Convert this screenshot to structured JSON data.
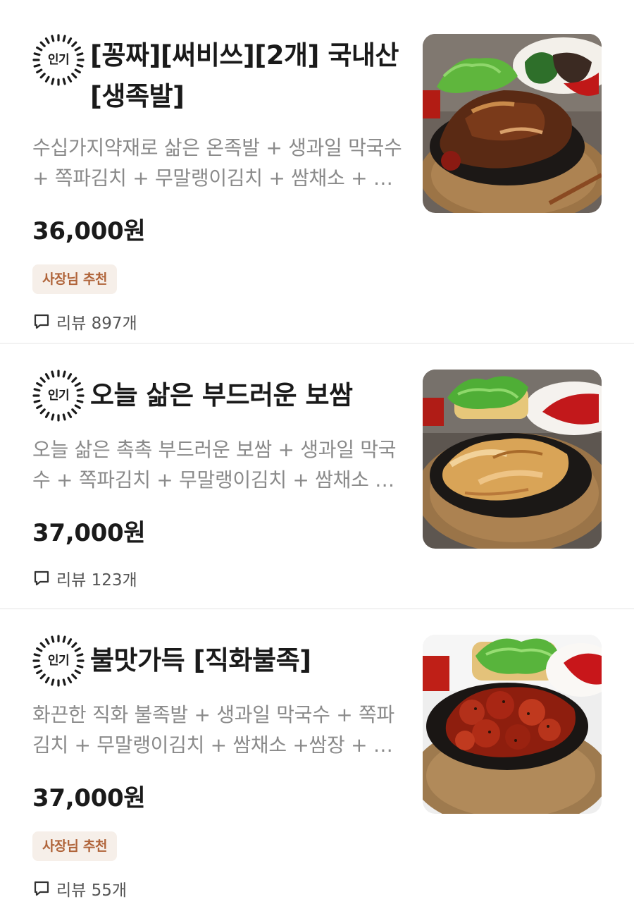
{
  "menu": {
    "items": [
      {
        "badge": "인기",
        "title": "[꽁짜][써비쓰][2개]  국내산 [생족발]",
        "description": "수십가지약재로 삶은 온족발 + 생과일 막국수 + 쪽파김치 + 무말랭이김치 + 쌈채소 + 쌈장 + 새우젓",
        "price": "36,000원",
        "recommend": "사장님 추천",
        "review": "리뷰 897개",
        "image_icon": "jokbal-photo"
      },
      {
        "badge": "인기",
        "title": "오늘 삶은 부드러운 보쌈",
        "description": "오늘 삶은 촉촉 부드러운 보쌈  + 생과일 막국수  + 쪽파김치 + 무말랭이김치 + 쌈채소 + 쌈장",
        "price": "37,000원",
        "recommend": "",
        "review": "리뷰 123개",
        "image_icon": "bossam-photo"
      },
      {
        "badge": "인기",
        "title": "불맛가득 [직화불족]",
        "description": "화끈한 직화 불족발 + 생과일 막국수  + 쪽파김치 + 무말랭이김치 + 쌈채소 +쌈장 + 새우젓",
        "price": "37,000원",
        "recommend": "사장님 추천",
        "review": "리뷰 55개",
        "image_icon": "fire-jokbal-photo"
      }
    ]
  },
  "colors": {
    "recommend_bg": "#f6efe9",
    "recommend_text": "#b0643a",
    "description": "#8a8a8a",
    "divider": "#f2f2f2"
  }
}
